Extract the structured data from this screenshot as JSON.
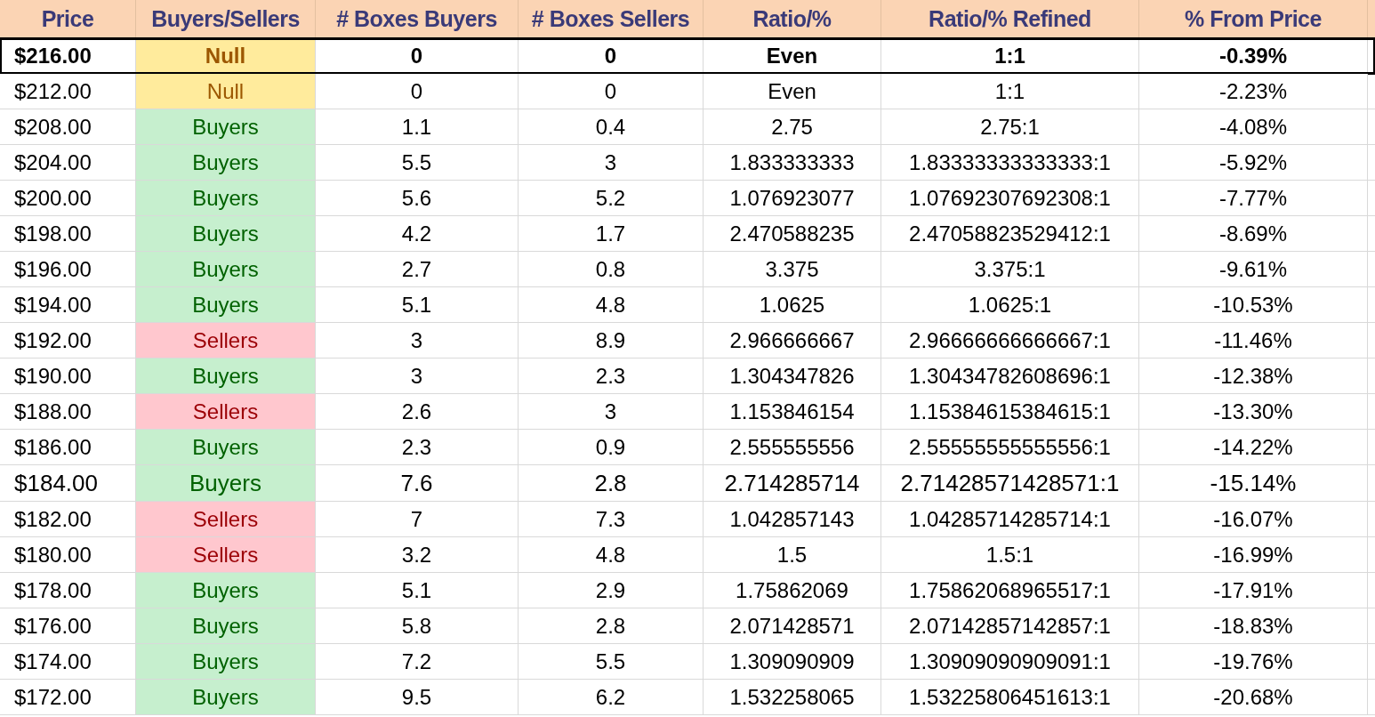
{
  "table": {
    "columns": [
      "Price",
      "Buyers/Sellers",
      "# Boxes Buyers",
      "# Boxes Sellers",
      "Ratio/%",
      "Ratio/% Refined",
      "% From Price"
    ],
    "rows": [
      {
        "price": "$216.00",
        "status": {
          "label": "Null",
          "kind": "null"
        },
        "buyers": "0",
        "sellers": "0",
        "ratio": "Even",
        "refined": "1:1",
        "from_price": "-0.39%",
        "highlighted": true,
        "large": false
      },
      {
        "price": "$212.00",
        "status": {
          "label": "Null",
          "kind": "null"
        },
        "buyers": "0",
        "sellers": "0",
        "ratio": "Even",
        "refined": "1:1",
        "from_price": "-2.23%",
        "highlighted": false,
        "large": false
      },
      {
        "price": "$208.00",
        "status": {
          "label": "Buyers",
          "kind": "buyers"
        },
        "buyers": "1.1",
        "sellers": "0.4",
        "ratio": "2.75",
        "refined": "2.75:1",
        "from_price": "-4.08%",
        "highlighted": false,
        "large": false
      },
      {
        "price": "$204.00",
        "status": {
          "label": "Buyers",
          "kind": "buyers"
        },
        "buyers": "5.5",
        "sellers": "3",
        "ratio": "1.833333333",
        "refined": "1.83333333333333:1",
        "from_price": "-5.92%",
        "highlighted": false,
        "large": false
      },
      {
        "price": "$200.00",
        "status": {
          "label": "Buyers",
          "kind": "buyers"
        },
        "buyers": "5.6",
        "sellers": "5.2",
        "ratio": "1.076923077",
        "refined": "1.07692307692308:1",
        "from_price": "-7.77%",
        "highlighted": false,
        "large": false
      },
      {
        "price": "$198.00",
        "status": {
          "label": "Buyers",
          "kind": "buyers"
        },
        "buyers": "4.2",
        "sellers": "1.7",
        "ratio": "2.470588235",
        "refined": "2.47058823529412:1",
        "from_price": "-8.69%",
        "highlighted": false,
        "large": false
      },
      {
        "price": "$196.00",
        "status": {
          "label": "Buyers",
          "kind": "buyers"
        },
        "buyers": "2.7",
        "sellers": "0.8",
        "ratio": "3.375",
        "refined": "3.375:1",
        "from_price": "-9.61%",
        "highlighted": false,
        "large": false
      },
      {
        "price": "$194.00",
        "status": {
          "label": "Buyers",
          "kind": "buyers"
        },
        "buyers": "5.1",
        "sellers": "4.8",
        "ratio": "1.0625",
        "refined": "1.0625:1",
        "from_price": "-10.53%",
        "highlighted": false,
        "large": false
      },
      {
        "price": "$192.00",
        "status": {
          "label": "Sellers",
          "kind": "sellers"
        },
        "buyers": "3",
        "sellers": "8.9",
        "ratio": "2.966666667",
        "refined": "2.96666666666667:1",
        "from_price": "-11.46%",
        "highlighted": false,
        "large": false
      },
      {
        "price": "$190.00",
        "status": {
          "label": "Buyers",
          "kind": "buyers"
        },
        "buyers": "3",
        "sellers": "2.3",
        "ratio": "1.304347826",
        "refined": "1.30434782608696:1",
        "from_price": "-12.38%",
        "highlighted": false,
        "large": false
      },
      {
        "price": "$188.00",
        "status": {
          "label": "Sellers",
          "kind": "sellers"
        },
        "buyers": "2.6",
        "sellers": "3",
        "ratio": "1.153846154",
        "refined": "1.15384615384615:1",
        "from_price": "-13.30%",
        "highlighted": false,
        "large": false
      },
      {
        "price": "$186.00",
        "status": {
          "label": "Buyers",
          "kind": "buyers"
        },
        "buyers": "2.3",
        "sellers": "0.9",
        "ratio": "2.555555556",
        "refined": "2.55555555555556:1",
        "from_price": "-14.22%",
        "highlighted": false,
        "large": false
      },
      {
        "price": "$184.00",
        "status": {
          "label": "Buyers",
          "kind": "buyers"
        },
        "buyers": "7.6",
        "sellers": "2.8",
        "ratio": "2.714285714",
        "refined": "2.71428571428571:1",
        "from_price": "-15.14%",
        "highlighted": false,
        "large": true
      },
      {
        "price": "$182.00",
        "status": {
          "label": "Sellers",
          "kind": "sellers"
        },
        "buyers": "7",
        "sellers": "7.3",
        "ratio": "1.042857143",
        "refined": "1.04285714285714:1",
        "from_price": "-16.07%",
        "highlighted": false,
        "large": false
      },
      {
        "price": "$180.00",
        "status": {
          "label": "Sellers",
          "kind": "sellers"
        },
        "buyers": "3.2",
        "sellers": "4.8",
        "ratio": "1.5",
        "refined": "1.5:1",
        "from_price": "-16.99%",
        "highlighted": false,
        "large": false
      },
      {
        "price": "$178.00",
        "status": {
          "label": "Buyers",
          "kind": "buyers"
        },
        "buyers": "5.1",
        "sellers": "2.9",
        "ratio": "1.75862069",
        "refined": "1.75862068965517:1",
        "from_price": "-17.91%",
        "highlighted": false,
        "large": false
      },
      {
        "price": "$176.00",
        "status": {
          "label": "Buyers",
          "kind": "buyers"
        },
        "buyers": "5.8",
        "sellers": "2.8",
        "ratio": "2.071428571",
        "refined": "2.07142857142857:1",
        "from_price": "-18.83%",
        "highlighted": false,
        "large": false
      },
      {
        "price": "$174.00",
        "status": {
          "label": "Buyers",
          "kind": "buyers"
        },
        "buyers": "7.2",
        "sellers": "5.5",
        "ratio": "1.309090909",
        "refined": "1.30909090909091:1",
        "from_price": "-19.76%",
        "highlighted": false,
        "large": false
      },
      {
        "price": "$172.00",
        "status": {
          "label": "Buyers",
          "kind": "buyers"
        },
        "buyers": "9.5",
        "sellers": "6.2",
        "ratio": "1.532258065",
        "refined": "1.53225806451613:1",
        "from_price": "-20.68%",
        "highlighted": false,
        "large": false
      }
    ]
  }
}
